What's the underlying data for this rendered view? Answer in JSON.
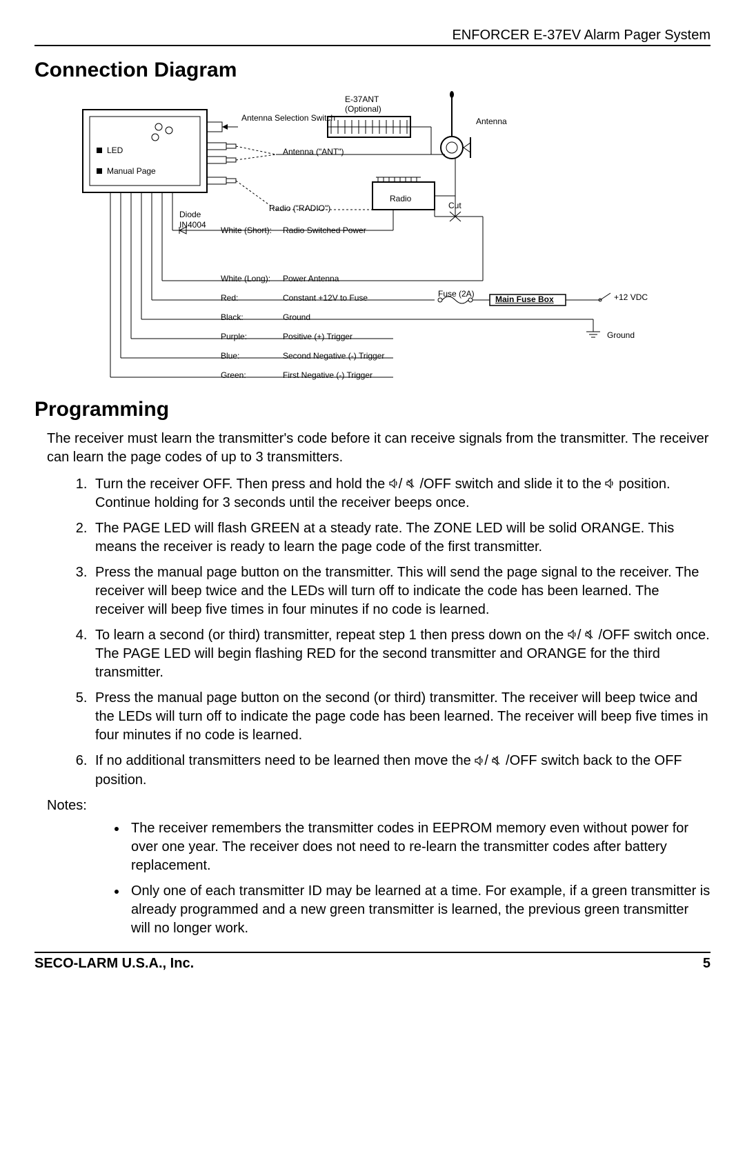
{
  "header": "ENFORCER E-37EV Alarm Pager System",
  "section1_title": "Connection Diagram",
  "diagram": {
    "led": "LED",
    "manual_page": "Manual Page",
    "antenna_sel_switch": "Antenna Selection Switch",
    "e37ant": "E-37ANT",
    "optional": "(Optional)",
    "antenna": "Antenna",
    "antenna_ant": "Antenna (\"ANT\")",
    "radio": "Radio",
    "radio_radio": "Radio (\"RADIO\")",
    "cut": "Cut",
    "diode": "Diode",
    "in4004": "IN4004",
    "fuse2a": "Fuse (2A)",
    "main_fuse_box": "Main Fuse Box",
    "v12": "+12 VDC",
    "ground": "Ground",
    "wires": [
      {
        "color": "White (Short):",
        "desc": "Radio Switched Power"
      },
      {
        "color": "White (Long):",
        "desc": "Power Antenna"
      },
      {
        "color": "Red:",
        "desc": "Constant +12V to Fuse"
      },
      {
        "color": "Black:",
        "desc": "Ground"
      },
      {
        "color": "Purple:",
        "desc": "Positive (+) Trigger"
      },
      {
        "color": "Blue:",
        "desc": "Second Negative (-) Trigger"
      },
      {
        "color": "Green:",
        "desc": "First Negative (-) Trigger"
      }
    ]
  },
  "section2_title": "Programming",
  "intro": "The receiver must learn the transmitter's code before it can receive signals from the transmitter. The receiver can learn the page codes of up to 3 transmitters.",
  "steps": [
    {
      "pre": "Turn the receiver OFF. Then press and hold the ",
      "mid": "/OFF switch and slide it to the ",
      "post": " position. Continue holding for 3 seconds until the receiver beeps once."
    },
    {
      "text": "The PAGE LED will flash GREEN at a steady rate. The ZONE LED will be solid ORANGE. This means the receiver is ready to learn the page code of the first transmitter."
    },
    {
      "text": "Press the manual page button on the transmitter. This will send the page signal to the receiver. The receiver will beep twice and the LEDs will turn off to indicate the code has been learned. The receiver will beep five times in four minutes if no code is learned."
    },
    {
      "pre": "To learn a second (or third) transmitter, repeat step 1 then press down on the ",
      "mid": " /OFF switch once. The PAGE LED will begin flashing RED for the second transmitter and ORANGE for the third transmitter.",
      "post": ""
    },
    {
      "text": "Press the manual page button on the second (or third) transmitter. The receiver will beep twice and the LEDs will turn off to indicate the page code has been learned. The receiver will beep five times in four minutes if no code is learned."
    },
    {
      "pre": "If no additional transmitters need to be learned then move the ",
      "mid": "/OFF switch back to the OFF position.",
      "post": ""
    }
  ],
  "notes_label": "Notes:",
  "notes": [
    "The receiver remembers the transmitter codes in EEPROM memory even without power for over one year. The receiver does not need to re-learn the transmitter codes after battery replacement.",
    "Only one of each transmitter ID may be learned at a time. For example, if a green transmitter is already programmed and a new green transmitter is learned, the previous green transmitter will no longer work."
  ],
  "footer_left": "SECO-LARM U.S.A., Inc.",
  "footer_right": "5"
}
